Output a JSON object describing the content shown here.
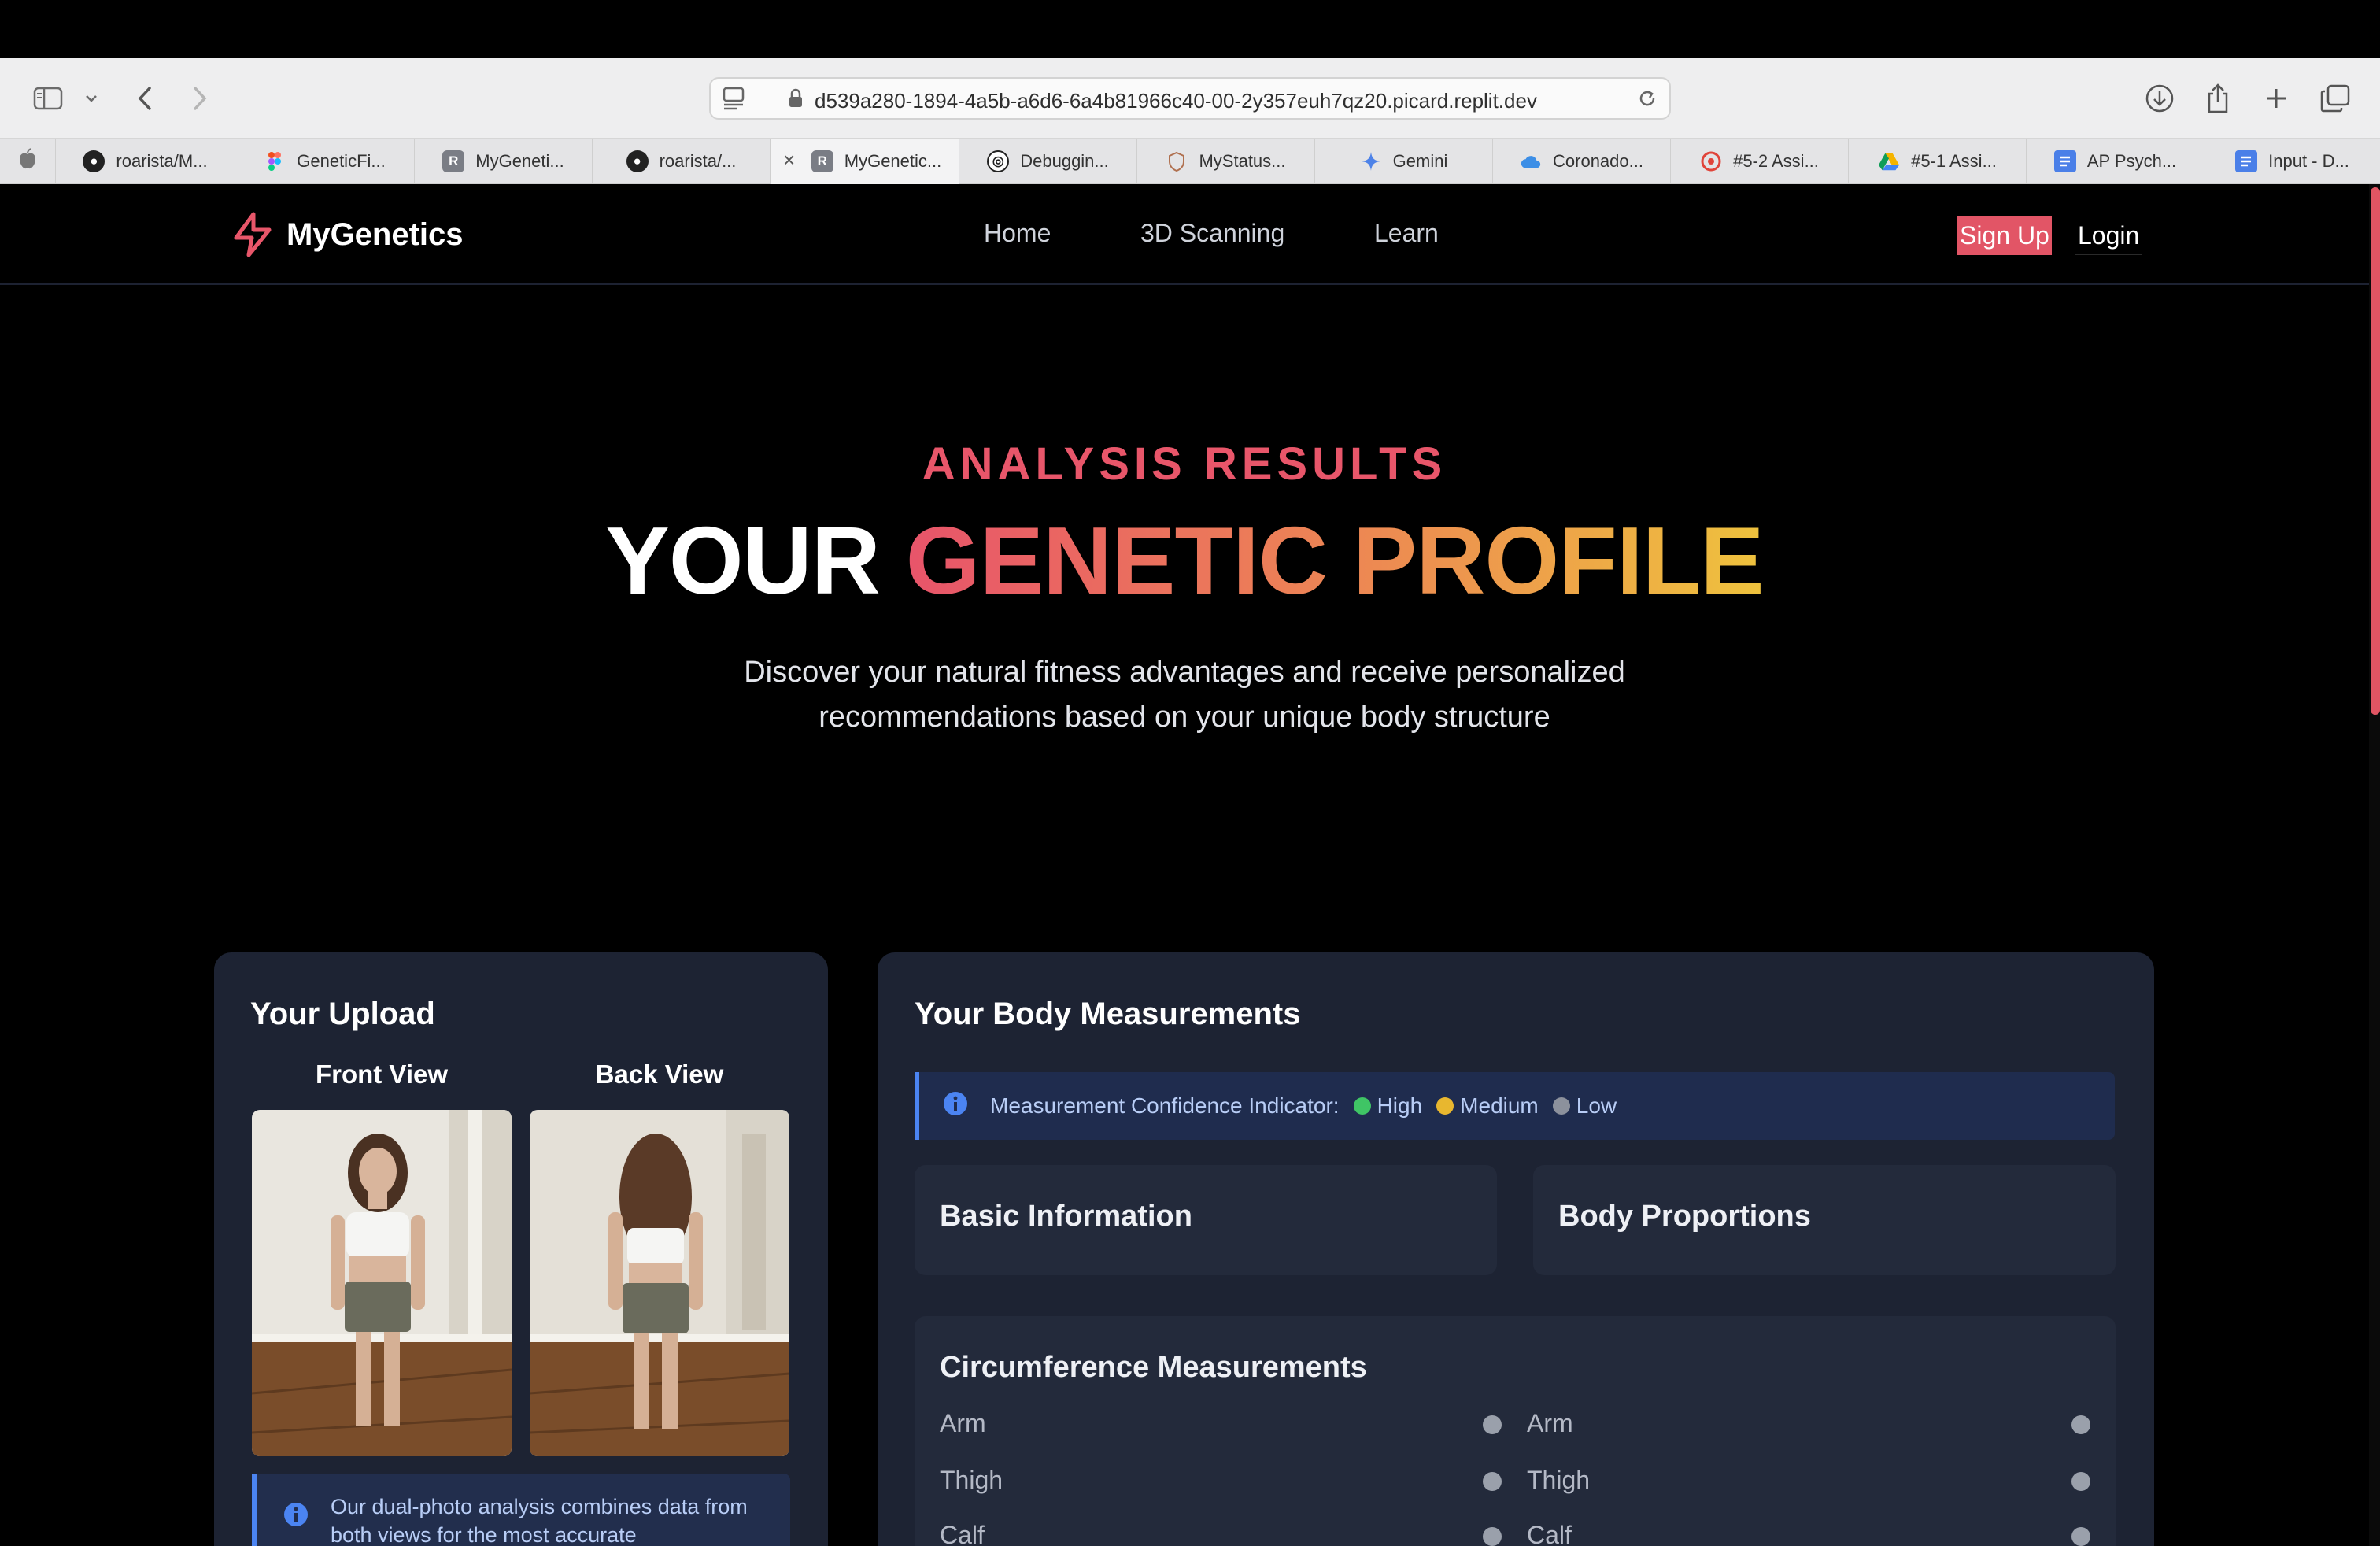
{
  "browser": {
    "url": "d539a280-1894-4a5b-a6d6-6a4b81966c40-00-2y357euh7qz20.picard.replit.dev",
    "tabs": [
      {
        "label": "roarista/M...",
        "icon": "github-icon"
      },
      {
        "label": "GeneticFi...",
        "icon": "figma-icon"
      },
      {
        "label": "MyGeneti...",
        "icon": "replit-icon"
      },
      {
        "label": "roarista/...",
        "icon": "github-icon"
      },
      {
        "label": "MyGenetic...",
        "icon": "replit-icon",
        "active": true
      },
      {
        "label": "Debuggin...",
        "icon": "openai-icon"
      },
      {
        "label": "MyStatus...",
        "icon": "shield-icon"
      },
      {
        "label": "Gemini",
        "icon": "gemini-icon"
      },
      {
        "label": "Coronado...",
        "icon": "cloud-icon"
      },
      {
        "label": "#5-2 Assi...",
        "icon": "canvas-icon"
      },
      {
        "label": "#5-1 Assi...",
        "icon": "drive-icon"
      },
      {
        "label": "AP Psych...",
        "icon": "docs-icon"
      },
      {
        "label": "Input - D...",
        "icon": "docs-icon"
      }
    ]
  },
  "nav": {
    "brand": "MyGenetics",
    "links": [
      "Home",
      "3D Scanning",
      "Learn"
    ],
    "signup": "Sign Up",
    "login": "Login"
  },
  "hero": {
    "eyebrow": "ANALYSIS RESULTS",
    "title_white": "YOUR",
    "title_gradient": "GENETIC PROFILE",
    "subtitle": "Discover your natural fitness advantages and receive personalized recommendations based on your unique body structure"
  },
  "upload": {
    "title": "Your Upload",
    "front_label": "Front View",
    "back_label": "Back View",
    "info": "Our dual-photo analysis combines data from both views for the most accurate"
  },
  "measurements": {
    "title": "Your Body Measurements",
    "confidence_label": "Measurement Confidence Indicator:",
    "levels": [
      {
        "label": "High",
        "color": "#3fc565"
      },
      {
        "label": "Medium",
        "color": "#e8b72f"
      },
      {
        "label": "Low",
        "color": "#8c919c"
      }
    ],
    "basic_info": "Basic Information",
    "body_proportions": "Body Proportions",
    "circumference": "Circumference Measurements",
    "rows_left": [
      "Arm",
      "Thigh",
      "Calf"
    ],
    "rows_right": [
      "Arm",
      "Thigh",
      "Calf"
    ]
  },
  "colors": {
    "accent": "#e8566a",
    "card": "#1d2333",
    "info": "#4b84f2"
  }
}
